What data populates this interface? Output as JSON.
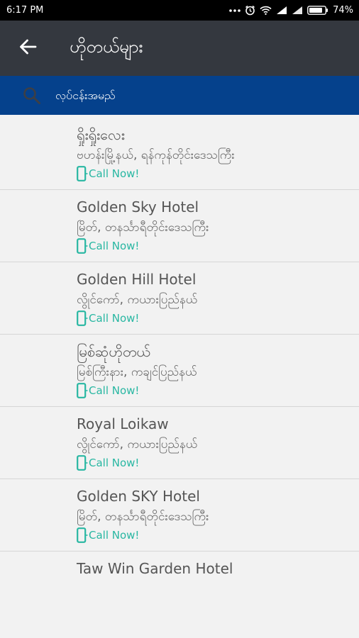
{
  "status_bar": {
    "time": "6:17 PM",
    "battery": "74%",
    "icons": [
      "dots-icon",
      "alarm-icon",
      "wifi-icon",
      "signal-icon",
      "signal-icon",
      "battery-icon"
    ]
  },
  "app_bar": {
    "title": "ဟိုတယ်များ",
    "back_icon": "arrow-left-icon"
  },
  "search": {
    "placeholder": "လုပ်ငန်းအမည်",
    "icon": "search-icon"
  },
  "colors": {
    "status_bar": "#000000",
    "app_bar": "#34383f",
    "search_bar": "#05418c",
    "accent": "#28b7a2",
    "list_bg": "#f2f2f2"
  },
  "hotels": [
    {
      "name": "ရှိုးရှိုးလေး",
      "address": "ဗဟန်းမြို့နယ်, ရန်ကုန်တိုင်းဒေသကြီး",
      "call_label": "Call Now!"
    },
    {
      "name": "Golden Sky Hotel",
      "address": "မြိတ်, တနင်္သာရီတိုင်းဒေသကြီး",
      "call_label": "Call Now!"
    },
    {
      "name": "Golden Hill Hotel",
      "address": "လွိုင်ကော်, ကယားပြည်နယ်",
      "call_label": "Call Now!"
    },
    {
      "name": "မြစ်ဆုံဟိုတယ်",
      "address": "မြစ်ကြီးနား, ကချင်ပြည်နယ်",
      "call_label": "Call Now!"
    },
    {
      "name": "Royal Loikaw",
      "address": "လွိုင်ကော်, ကယားပြည်နယ်",
      "call_label": "Call Now!"
    },
    {
      "name": "Golden SKY Hotel",
      "address": "မြိတ်, တနင်္သာရီတိုင်းဒေသကြီး",
      "call_label": "Call Now!"
    },
    {
      "name": "Taw Win Garden Hotel"
    }
  ]
}
